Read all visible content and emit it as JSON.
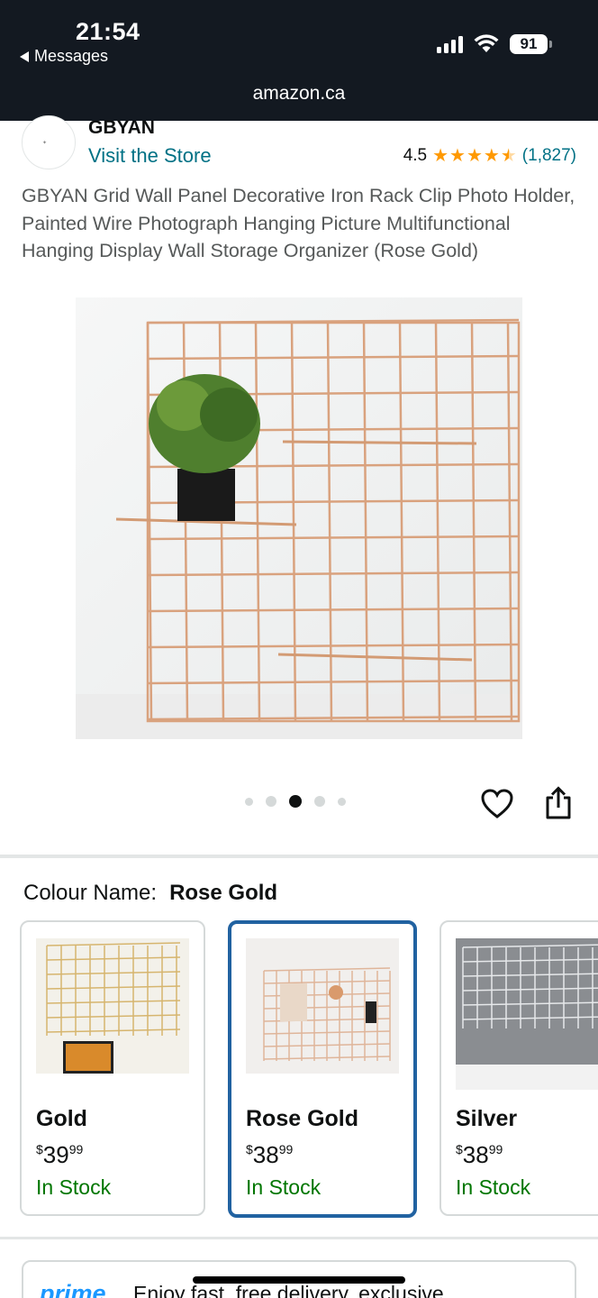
{
  "status_bar": {
    "time": "21:54",
    "back_label": "Messages",
    "battery": "91",
    "url": "amazon.ca"
  },
  "store": {
    "brand": "GBYAN",
    "visit_label": "Visit the Store",
    "rating": "4.5",
    "rating_count": "(1,827)",
    "stars_value": 4.5
  },
  "product": {
    "title": "GBYAN Grid Wall Panel Decorative Iron Rack Clip Photo Holder, Painted Wire Photograph Hanging Picture Multifunctional Hanging Display Wall Storage Organizer (Rose Gold)",
    "image_count": 5,
    "active_image_index": 2
  },
  "colour": {
    "label": "Colour Name:",
    "selected": "Rose Gold"
  },
  "swatches": [
    {
      "name": "Gold",
      "price_symbol": "$",
      "price_whole": "39",
      "price_cents": "99",
      "stock": "In Stock"
    },
    {
      "name": "Rose Gold",
      "price_symbol": "$",
      "price_whole": "38",
      "price_cents": "99",
      "stock": "In Stock"
    },
    {
      "name": "Silver",
      "price_symbol": "$",
      "price_whole": "38",
      "price_cents": "99",
      "stock": "In Stock"
    }
  ],
  "prime": {
    "logo": "prime",
    "text": "Enjoy fast, free delivery, exclusive"
  },
  "icons": {
    "back": "back-triangle-icon",
    "heart": "heart-icon",
    "share": "share-icon"
  },
  "colors": {
    "header_bg": "#131921",
    "link": "#007185",
    "star": "#ff9900",
    "in_stock": "#007600",
    "selected_border": "#2162a1",
    "prime_blue": "#1a98ff"
  }
}
